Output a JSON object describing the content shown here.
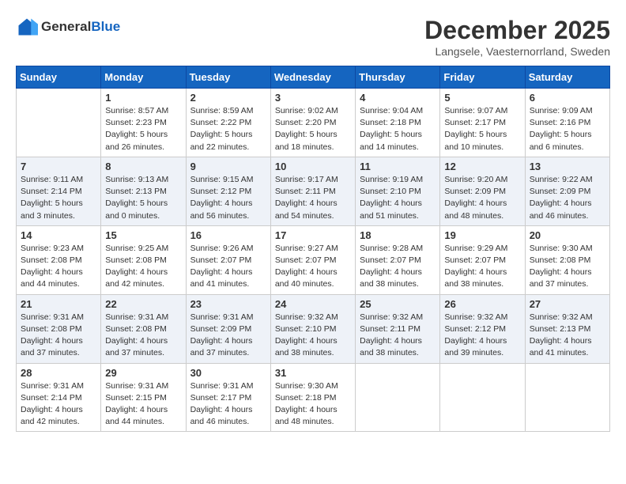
{
  "logo": {
    "general": "General",
    "blue": "Blue"
  },
  "title": "December 2025",
  "location": "Langsele, Vaesternorrland, Sweden",
  "days": [
    "Sunday",
    "Monday",
    "Tuesday",
    "Wednesday",
    "Thursday",
    "Friday",
    "Saturday"
  ],
  "weeks": [
    [
      {
        "day": "",
        "info": ""
      },
      {
        "day": "1",
        "info": "Sunrise: 8:57 AM\nSunset: 2:23 PM\nDaylight: 5 hours\nand 26 minutes."
      },
      {
        "day": "2",
        "info": "Sunrise: 8:59 AM\nSunset: 2:22 PM\nDaylight: 5 hours\nand 22 minutes."
      },
      {
        "day": "3",
        "info": "Sunrise: 9:02 AM\nSunset: 2:20 PM\nDaylight: 5 hours\nand 18 minutes."
      },
      {
        "day": "4",
        "info": "Sunrise: 9:04 AM\nSunset: 2:18 PM\nDaylight: 5 hours\nand 14 minutes."
      },
      {
        "day": "5",
        "info": "Sunrise: 9:07 AM\nSunset: 2:17 PM\nDaylight: 5 hours\nand 10 minutes."
      },
      {
        "day": "6",
        "info": "Sunrise: 9:09 AM\nSunset: 2:16 PM\nDaylight: 5 hours\nand 6 minutes."
      }
    ],
    [
      {
        "day": "7",
        "info": "Sunrise: 9:11 AM\nSunset: 2:14 PM\nDaylight: 5 hours\nand 3 minutes."
      },
      {
        "day": "8",
        "info": "Sunrise: 9:13 AM\nSunset: 2:13 PM\nDaylight: 5 hours\nand 0 minutes."
      },
      {
        "day": "9",
        "info": "Sunrise: 9:15 AM\nSunset: 2:12 PM\nDaylight: 4 hours\nand 56 minutes."
      },
      {
        "day": "10",
        "info": "Sunrise: 9:17 AM\nSunset: 2:11 PM\nDaylight: 4 hours\nand 54 minutes."
      },
      {
        "day": "11",
        "info": "Sunrise: 9:19 AM\nSunset: 2:10 PM\nDaylight: 4 hours\nand 51 minutes."
      },
      {
        "day": "12",
        "info": "Sunrise: 9:20 AM\nSunset: 2:09 PM\nDaylight: 4 hours\nand 48 minutes."
      },
      {
        "day": "13",
        "info": "Sunrise: 9:22 AM\nSunset: 2:09 PM\nDaylight: 4 hours\nand 46 minutes."
      }
    ],
    [
      {
        "day": "14",
        "info": "Sunrise: 9:23 AM\nSunset: 2:08 PM\nDaylight: 4 hours\nand 44 minutes."
      },
      {
        "day": "15",
        "info": "Sunrise: 9:25 AM\nSunset: 2:08 PM\nDaylight: 4 hours\nand 42 minutes."
      },
      {
        "day": "16",
        "info": "Sunrise: 9:26 AM\nSunset: 2:07 PM\nDaylight: 4 hours\nand 41 minutes."
      },
      {
        "day": "17",
        "info": "Sunrise: 9:27 AM\nSunset: 2:07 PM\nDaylight: 4 hours\nand 40 minutes."
      },
      {
        "day": "18",
        "info": "Sunrise: 9:28 AM\nSunset: 2:07 PM\nDaylight: 4 hours\nand 38 minutes."
      },
      {
        "day": "19",
        "info": "Sunrise: 9:29 AM\nSunset: 2:07 PM\nDaylight: 4 hours\nand 38 minutes."
      },
      {
        "day": "20",
        "info": "Sunrise: 9:30 AM\nSunset: 2:08 PM\nDaylight: 4 hours\nand 37 minutes."
      }
    ],
    [
      {
        "day": "21",
        "info": "Sunrise: 9:31 AM\nSunset: 2:08 PM\nDaylight: 4 hours\nand 37 minutes."
      },
      {
        "day": "22",
        "info": "Sunrise: 9:31 AM\nSunset: 2:08 PM\nDaylight: 4 hours\nand 37 minutes."
      },
      {
        "day": "23",
        "info": "Sunrise: 9:31 AM\nSunset: 2:09 PM\nDaylight: 4 hours\nand 37 minutes."
      },
      {
        "day": "24",
        "info": "Sunrise: 9:32 AM\nSunset: 2:10 PM\nDaylight: 4 hours\nand 38 minutes."
      },
      {
        "day": "25",
        "info": "Sunrise: 9:32 AM\nSunset: 2:11 PM\nDaylight: 4 hours\nand 38 minutes."
      },
      {
        "day": "26",
        "info": "Sunrise: 9:32 AM\nSunset: 2:12 PM\nDaylight: 4 hours\nand 39 minutes."
      },
      {
        "day": "27",
        "info": "Sunrise: 9:32 AM\nSunset: 2:13 PM\nDaylight: 4 hours\nand 41 minutes."
      }
    ],
    [
      {
        "day": "28",
        "info": "Sunrise: 9:31 AM\nSunset: 2:14 PM\nDaylight: 4 hours\nand 42 minutes."
      },
      {
        "day": "29",
        "info": "Sunrise: 9:31 AM\nSunset: 2:15 PM\nDaylight: 4 hours\nand 44 minutes."
      },
      {
        "day": "30",
        "info": "Sunrise: 9:31 AM\nSunset: 2:17 PM\nDaylight: 4 hours\nand 46 minutes."
      },
      {
        "day": "31",
        "info": "Sunrise: 9:30 AM\nSunset: 2:18 PM\nDaylight: 4 hours\nand 48 minutes."
      },
      {
        "day": "",
        "info": ""
      },
      {
        "day": "",
        "info": ""
      },
      {
        "day": "",
        "info": ""
      }
    ]
  ]
}
